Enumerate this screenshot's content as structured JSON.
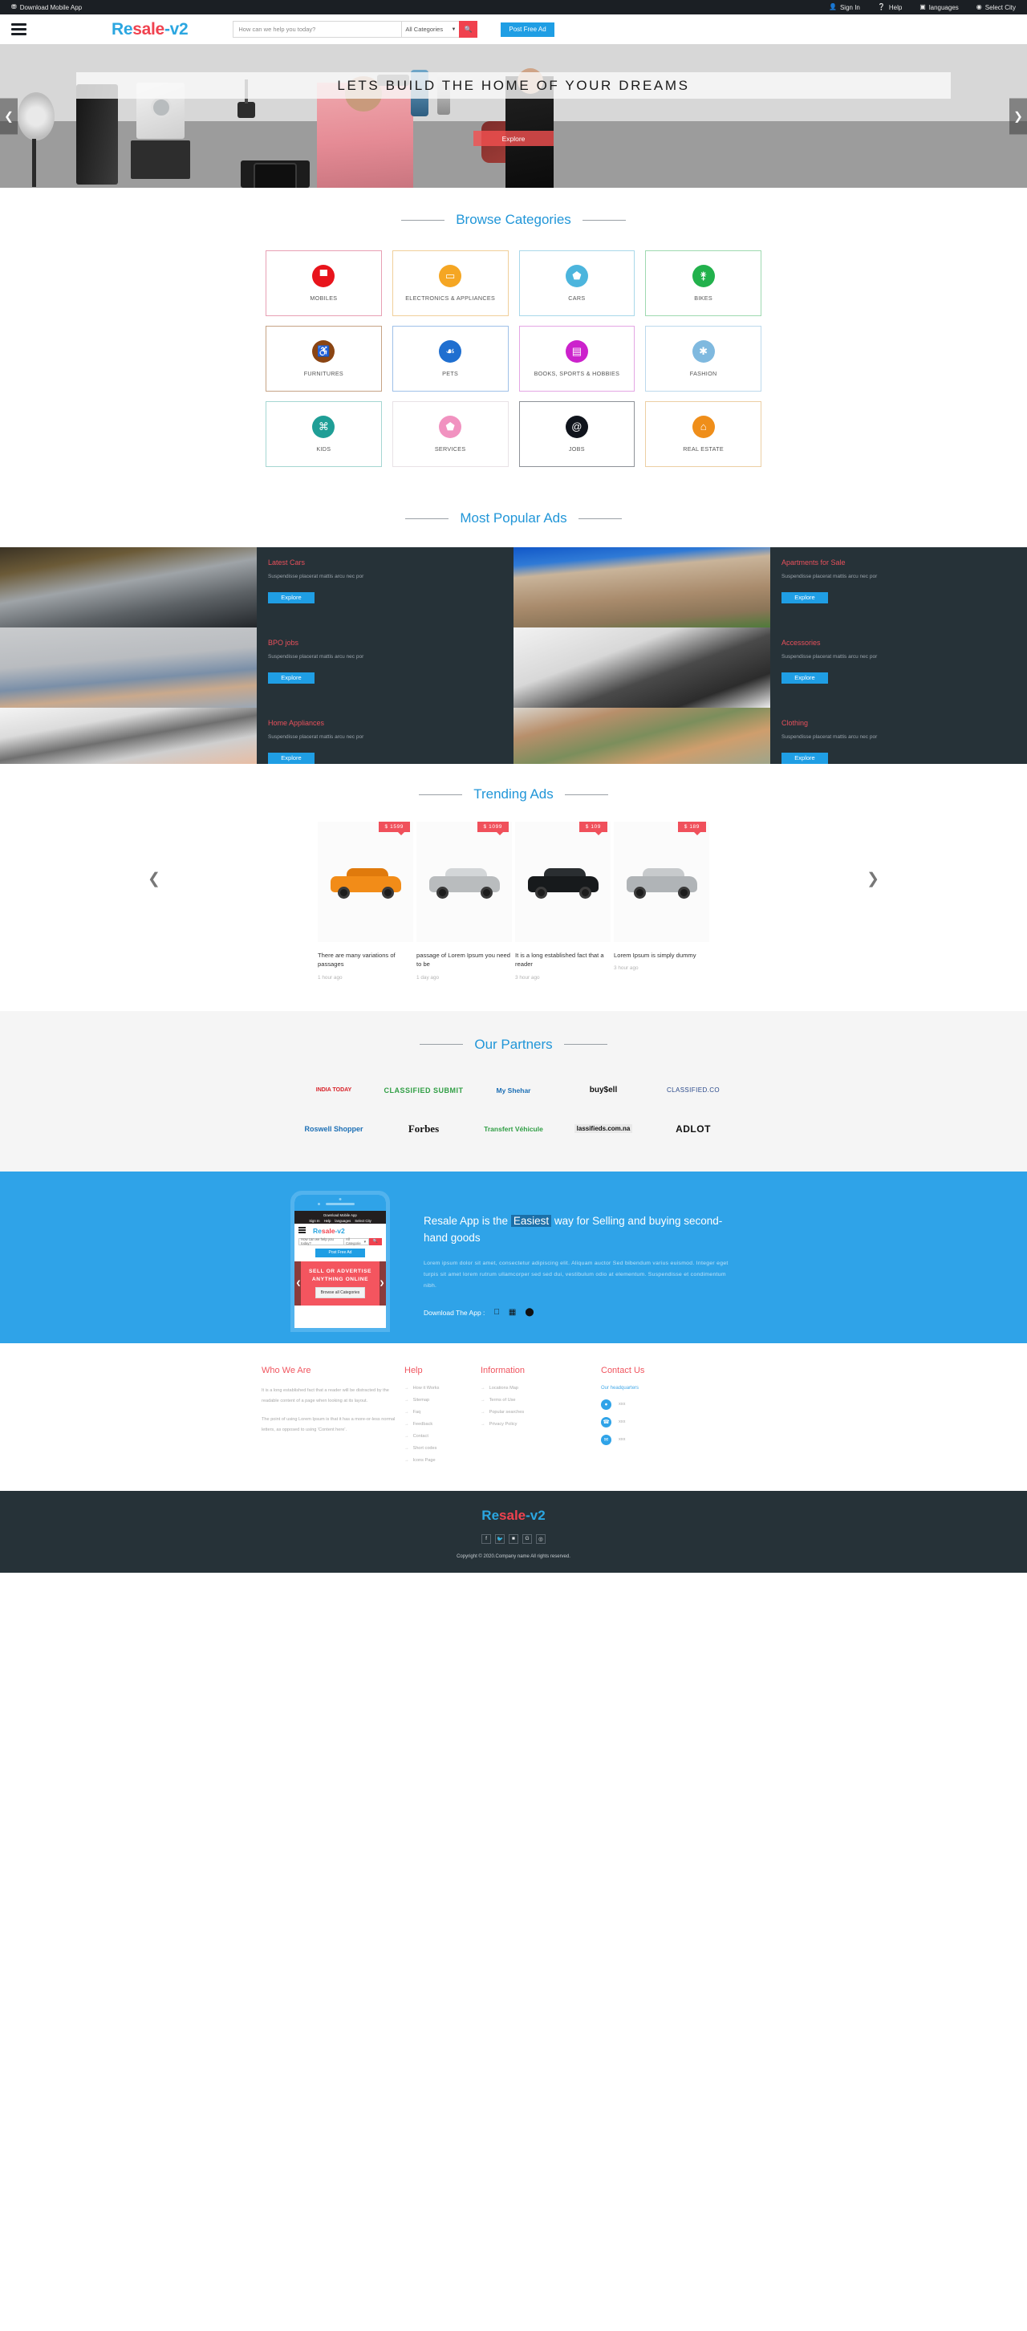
{
  "topbar": {
    "download_app": "Download Mobile App",
    "download_icon": "download-icon",
    "links": [
      {
        "label": "Sign In",
        "icon": "user-icon"
      },
      {
        "label": "Help",
        "icon": "question-circle-icon"
      },
      {
        "label": "languages",
        "icon": "language-icon"
      },
      {
        "label": "Select City",
        "icon": "globe-icon"
      }
    ]
  },
  "header": {
    "brand": {
      "part1": "Re",
      "part2": "sale",
      "part3": "-v2"
    },
    "search_placeholder": "How can we help you today?",
    "search_value": "",
    "category_selected": "All Categories",
    "search_icon": "search-icon",
    "post_ad_label": "Post Free Ad",
    "menu_icon": "hamburger-icon"
  },
  "hero": {
    "caption": "LETS BUILD THE HOME OF YOUR DREAMS",
    "explore_label": "Explore",
    "prev_icon": "chevron-left-icon",
    "next_icon": "chevron-right-icon"
  },
  "categories": {
    "title": "Browse Categories",
    "items": [
      {
        "label": "MOBILES",
        "icon": "mobile-icon",
        "glyph": "▀",
        "color": "#e8141c",
        "border": "#e8a0b4"
      },
      {
        "label": "ELECTRONICS & APPLIANCES",
        "icon": "laptop-icon",
        "glyph": "▭",
        "color": "#f5a623",
        "border": "#f0cf9a"
      },
      {
        "label": "CARS",
        "icon": "car-icon",
        "glyph": "⬟",
        "color": "#4cb5dd",
        "border": "#a9d8ea"
      },
      {
        "label": "BIKES",
        "icon": "bicycle-icon",
        "glyph": "⚵",
        "color": "#22b14c",
        "border": "#9ed9b0"
      },
      {
        "label": "FURNITURES",
        "icon": "wheelchair-icon",
        "glyph": "♿",
        "color": "#8b4513",
        "border": "#c6a385"
      },
      {
        "label": "PETS",
        "icon": "paw-icon",
        "glyph": "☙",
        "color": "#1f6fd0",
        "border": "#9fc0e8"
      },
      {
        "label": "BOOKS, SPORTS & HOBBIES",
        "icon": "book-icon",
        "glyph": "▤",
        "color": "#cc22cc",
        "border": "#e4a6e4"
      },
      {
        "label": "FASHION",
        "icon": "asterisk-icon",
        "glyph": "✱",
        "color": "#7fb9df",
        "border": "#bcd9ec"
      },
      {
        "label": "KIDS",
        "icon": "gamepad-icon",
        "glyph": "⌘",
        "color": "#1f9e96",
        "border": "#a5d6d2"
      },
      {
        "label": "SERVICES",
        "icon": "shield-icon",
        "glyph": "⬟",
        "color": "#f192c0",
        "border": "#e8e2e6"
      },
      {
        "label": "JOBS",
        "icon": "at-icon",
        "glyph": "@",
        "color": "#10141c",
        "border": "#8e9298"
      },
      {
        "label": "REAL ESTATE",
        "icon": "home-icon",
        "glyph": "⌂",
        "color": "#ef8e1a",
        "border": "#eccfa4"
      }
    ]
  },
  "popular": {
    "title": "Most Popular Ads",
    "items": [
      {
        "heading": "Latest Cars",
        "desc": "Suspendisse placerat mattis arcu nec por",
        "button": "Explore",
        "image": "car-photo"
      },
      {
        "heading": "Apartments for Sale",
        "desc": "Suspendisse placerat mattis arcu nec por",
        "button": "Explore",
        "image": "apartment-photo"
      },
      {
        "heading": "BPO jobs",
        "desc": "Suspendisse placerat mattis arcu nec por",
        "button": "Explore",
        "image": "person-photo"
      },
      {
        "heading": "Accessories",
        "desc": "Suspendisse placerat mattis arcu nec por",
        "button": "Explore",
        "image": "headphones-photo"
      },
      {
        "heading": "Home Appliances",
        "desc": "Suspendisse placerat mattis arcu nec por",
        "button": "Explore",
        "image": "cookware-photo"
      },
      {
        "heading": "Clothing",
        "desc": "Suspendisse placerat mattis arcu nec por",
        "button": "Explore",
        "image": "shirt-photo"
      }
    ]
  },
  "trending": {
    "title": "Trending Ads",
    "prev_icon": "chevron-left-icon",
    "next_icon": "chevron-right-icon",
    "items": [
      {
        "price": "$ 1599",
        "title": "There are many variations of passages",
        "time": "1 hour ago",
        "body_color": "#f28c18",
        "roof_color": "#e07a0c"
      },
      {
        "price": "$ 1099",
        "title": "passage of Lorem Ipsum you need to be",
        "time": "1 day ago",
        "body_color": "#b9bcbe",
        "roof_color": "#d3d6d8"
      },
      {
        "price": "$ 109",
        "title": "It is a long established fact that a reader",
        "time": "3 hour ago",
        "body_color": "#171a1c",
        "roof_color": "#2a2e31"
      },
      {
        "price": "$ 189",
        "title": "Lorem Ipsum is simply dummy",
        "time": "3 hour ago",
        "body_color": "#b0b4b7",
        "roof_color": "#c7cacc"
      }
    ]
  },
  "partners": {
    "title": "Our Partners",
    "logos": [
      {
        "name": "India Today",
        "text": "INDIA TODAY"
      },
      {
        "name": "Classified Submit",
        "text": "CLASSIFIED SUBMIT"
      },
      {
        "name": "My Shehar",
        "text": "My Shehar"
      },
      {
        "name": "buysell",
        "text": "buy$ell"
      },
      {
        "name": "Classified.co",
        "text": "CLASSIFIED.CO"
      },
      {
        "name": "Roswell Shopper",
        "text": "Roswell Shopper"
      },
      {
        "name": "Forbes",
        "text": "Forbes"
      },
      {
        "name": "Transfert Vehicule",
        "text": "Transfert Véhicule"
      },
      {
        "name": "Classifieds.com.na",
        "text": "lassifieds.com.na"
      },
      {
        "name": "ADLOT Classifieds",
        "text": "ADLOT"
      }
    ]
  },
  "app_promo": {
    "heading_pre": "Resale App is the",
    "heading_hl": "Easiest",
    "heading_post": "way for Selling and buying second-hand goods",
    "paragraph": "Lorem ipsum dolor sit amet, consectetur adipiscing elit. Aliquam auctor Sed bibendum varius euismod. Integer eget turpis sit amet lorem rutrum ullamcorper sed sed dui, vestibulum odio at elementum. Suspendisse et condimentum nibh.",
    "download_label": "Download The App :",
    "os_icons": [
      {
        "name": "apple-icon",
        "glyph": "\u0001"
      },
      {
        "name": "windows-icon",
        "glyph": "⊞"
      },
      {
        "name": "android-icon",
        "glyph": "⬤"
      }
    ],
    "phone": {
      "topbar_download": "Download Mobile App",
      "topbar_links": [
        "Sign In",
        "Help",
        "languages",
        "Select City"
      ],
      "brand": {
        "part1": "Re",
        "part2": "sale",
        "part3": "-v2"
      },
      "search_placeholder": "How can we help you today?",
      "category_selected": "All Categorie",
      "post_ad_label": "Post Free Ad",
      "hero_text": "SELL OR ADVERTISE ANYTHING ONLINE",
      "hero_button": "Browse all Categories"
    }
  },
  "footer": {
    "who": {
      "title": "Who We Are",
      "p1": "It is a long established fact that a reader will be distracted by the readable content of a page when looking at its layout.",
      "p2": "The point of using Lorem Ipsum is that it has a more-or-less normal letters, as opposed to using 'Content here'."
    },
    "help": {
      "title": "Help",
      "links": [
        "How it Works",
        "Sitemap",
        "Faq",
        "Feedback",
        "Contact",
        "Short codes",
        "Icons Page"
      ]
    },
    "information": {
      "title": "Information",
      "links": [
        "Locations Map",
        "Terms of Use",
        "Popular searches",
        "Privacy Policy"
      ]
    },
    "contact": {
      "title": "Contact Us",
      "subtitle": "Our headquarters",
      "rows": [
        {
          "icon": "location-pin-icon",
          "glyph": "•",
          "value": "xxx"
        },
        {
          "icon": "phone-icon",
          "glyph": "☎",
          "value": "xxx"
        },
        {
          "icon": "envelope-icon",
          "glyph": "✉",
          "value": "xxx"
        }
      ]
    }
  },
  "bottom": {
    "brand": {
      "part1": "Re",
      "part2": "sale",
      "part3": "-v2"
    },
    "socials": [
      {
        "name": "facebook-icon",
        "glyph": "f"
      },
      {
        "name": "twitter-icon",
        "glyph": "ᴠ"
      },
      {
        "name": "flickr-icon",
        "glyph": "▪"
      },
      {
        "name": "google-plus-icon",
        "glyph": "G"
      },
      {
        "name": "dribbble-icon",
        "glyph": "◎"
      }
    ],
    "copyright": "Copyright © 2020.Company name All rights reserved."
  }
}
